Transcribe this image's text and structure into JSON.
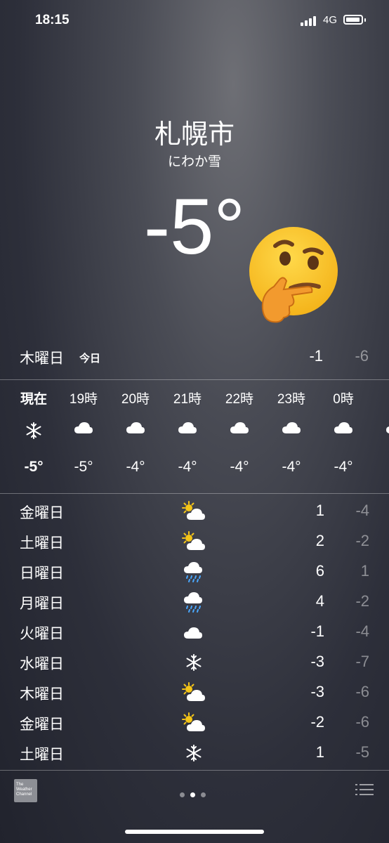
{
  "status_bar": {
    "time": "18:15",
    "network": "4G"
  },
  "header": {
    "city": "札幌市",
    "condition": "にわか雪",
    "temperature": "-5°"
  },
  "today": {
    "day": "木曜日",
    "tag": "今日",
    "high": "-1",
    "low": "-6"
  },
  "hourly": [
    {
      "label": "現在",
      "icon": "snowflake-icon",
      "temp": "-5°"
    },
    {
      "label": "19時",
      "icon": "cloud-icon",
      "temp": "-5°"
    },
    {
      "label": "20時",
      "icon": "cloud-icon",
      "temp": "-4°"
    },
    {
      "label": "21時",
      "icon": "cloud-icon",
      "temp": "-4°"
    },
    {
      "label": "22時",
      "icon": "cloud-icon",
      "temp": "-4°"
    },
    {
      "label": "23時",
      "icon": "cloud-icon",
      "temp": "-4°"
    },
    {
      "label": "0時",
      "icon": "cloud-icon",
      "temp": "-4°"
    }
  ],
  "daily": [
    {
      "day": "金曜日",
      "icon": "sun-cloud-icon",
      "high": "1",
      "low": "-4"
    },
    {
      "day": "土曜日",
      "icon": "sun-cloud-icon",
      "high": "2",
      "low": "-2"
    },
    {
      "day": "日曜日",
      "icon": "rain-cloud-icon",
      "high": "6",
      "low": "1"
    },
    {
      "day": "月曜日",
      "icon": "rain-cloud-icon",
      "high": "4",
      "low": "-2"
    },
    {
      "day": "火曜日",
      "icon": "cloud-icon",
      "high": "-1",
      "low": "-4"
    },
    {
      "day": "水曜日",
      "icon": "snowflake-icon",
      "high": "-3",
      "low": "-7"
    },
    {
      "day": "木曜日",
      "icon": "sun-cloud-icon",
      "high": "-3",
      "low": "-6"
    },
    {
      "day": "金曜日",
      "icon": "sun-cloud-icon",
      "high": "-2",
      "low": "-6"
    },
    {
      "day": "土曜日",
      "icon": "snowflake-icon",
      "high": "1",
      "low": "-5"
    }
  ],
  "footer": {
    "logo_lines": [
      "The",
      "Weather",
      "Channel"
    ],
    "pages": 3,
    "active_page": 2
  },
  "colors": {
    "accent": "#ffffff",
    "muted": "#9a9ba2",
    "sun": "#f5c518",
    "rain": "#4aa8ff"
  }
}
